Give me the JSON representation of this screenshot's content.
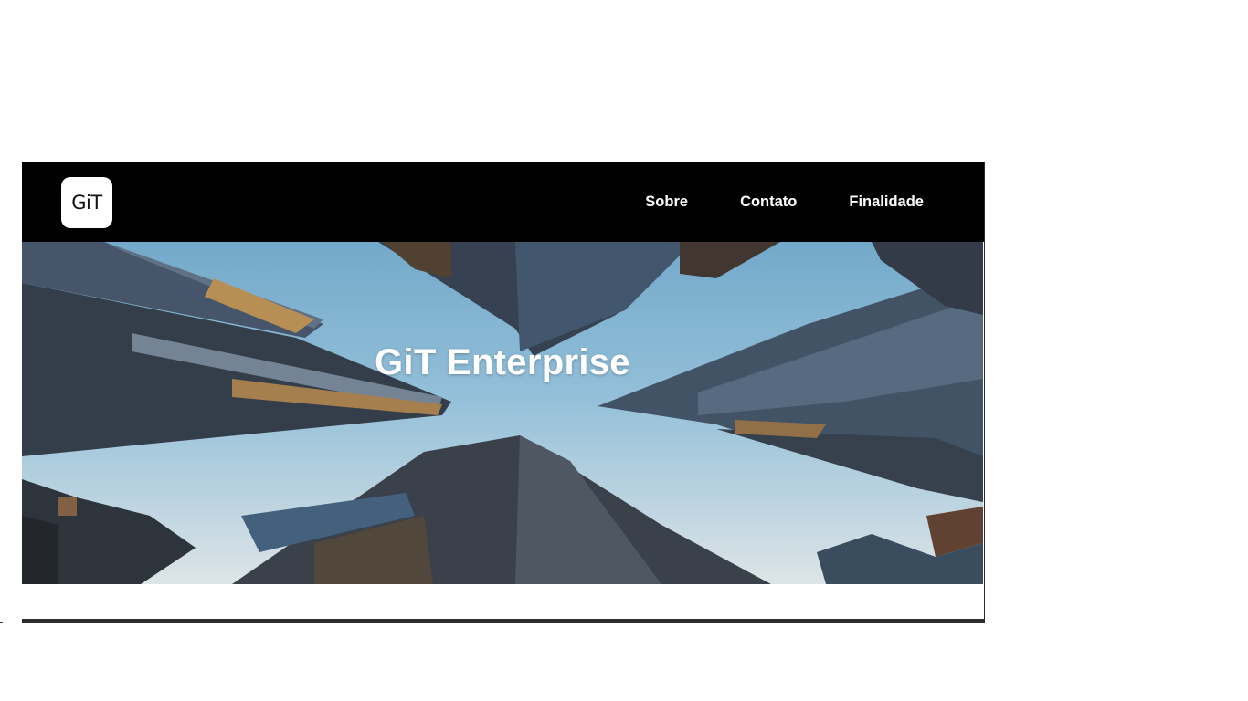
{
  "brand": {
    "logo_text": "GiT"
  },
  "nav": {
    "items": [
      {
        "label": "Sobre"
      },
      {
        "label": "Contato"
      },
      {
        "label": "Finalidade"
      }
    ]
  },
  "hero": {
    "title": "GiT Enterprise",
    "background": "skyscrapers-photo"
  },
  "colors": {
    "navbar": "#000000",
    "text": "#ffffff",
    "sky": "#8fbdd8"
  }
}
